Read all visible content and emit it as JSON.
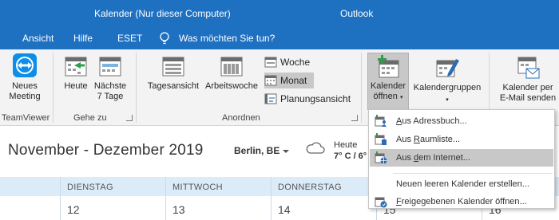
{
  "titlebar": {
    "left": "Kalender (Nur dieser Computer)",
    "right": "Outlook"
  },
  "menubar": {
    "items": [
      "Ansicht",
      "Hilfe",
      "ESET"
    ],
    "tell_me": "Was möchten Sie tun?"
  },
  "ribbon": {
    "teamviewer": {
      "label": "Neues\nMeeting",
      "group": "TeamViewer"
    },
    "goto": {
      "today": "Heute",
      "next7": "Nächste\n7 Tage",
      "group": "Gehe zu"
    },
    "arrange": {
      "day": "Tagesansicht",
      "workweek": "Arbeitswoche",
      "week": "Woche",
      "month": "Monat",
      "schedule": "Planungsansicht",
      "group": "Anordnen"
    },
    "open_calendar": {
      "line1": "Kalender",
      "line2": "öffnen"
    },
    "calendar_groups": "Kalendergruppen",
    "email_calendar": {
      "line1": "Kalender per",
      "line2": "E-Mail senden"
    }
  },
  "calendar": {
    "title": "November - Dezember 2019",
    "city": "Berlin, BE",
    "weather_label": "Heute",
    "weather_temp": "7° C / 6°",
    "days": [
      "DIENSTAG",
      "MITTWOCH",
      "DONNERSTAG"
    ],
    "dates": [
      "12",
      "13",
      "14",
      "15",
      "16"
    ]
  },
  "dropdown": {
    "items": [
      {
        "label": "Aus Adressbuch...",
        "icon": "address-book-icon"
      },
      {
        "label": "Aus Raumliste...",
        "icon": "room-list-icon"
      },
      {
        "label": "Aus dem Internet...",
        "icon": "internet-calendar-icon",
        "highlighted": true
      },
      {
        "label": "Neuen leeren Kalender erstellen...",
        "icon": ""
      },
      {
        "label": "Freigegebenen Kalender öffnen...",
        "icon": "shared-calendar-icon"
      }
    ]
  }
}
